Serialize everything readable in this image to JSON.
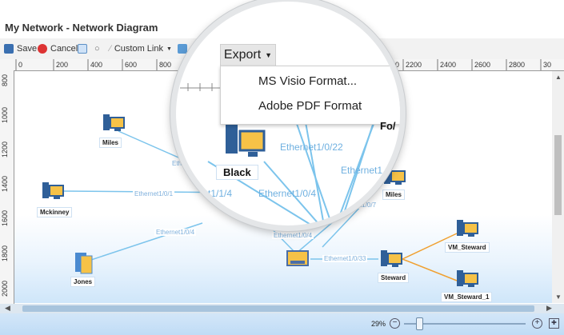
{
  "window": {
    "title": "My Network - Network Diagram"
  },
  "toolbar": {
    "save_label": "Save",
    "cancel_label": "Cancel",
    "custom_link_label": "Custom Link",
    "export_label": "Export"
  },
  "export_menu": {
    "items": [
      "MS Visio Format...",
      "Adobe PDF Format"
    ]
  },
  "rulers": {
    "horizontal": [
      "0",
      "200",
      "400",
      "600",
      "800",
      "200",
      "2200",
      "2400",
      "2600",
      "2800",
      "30"
    ],
    "vertical": [
      "800",
      "1000",
      "1200",
      "1400",
      "1600",
      "1800",
      "2000"
    ]
  },
  "nodes": {
    "miles_left": "Miles",
    "mckinney": "Mckinney",
    "jones": "Jones",
    "black": "Black",
    "fo_partial": "Fo/",
    "miles_right": "Miles",
    "steward": "Steward",
    "vm_steward": "VM_Steward",
    "vm_steward_1": "VM_Steward_1"
  },
  "edges": {
    "e_miles": "Ethern",
    "e_mckinney": "Ethernet1/0/1",
    "e_jones": "Ethernet1/0/4",
    "e_center": "Ethernet1/0/4",
    "e_steward": "Ethernet1/0/33",
    "e_miles_right": "Ethernet1/0/7",
    "lens_e1": "Ethernet1/0/22",
    "lens_e2": "Ethernet1",
    "lens_e3": "Ethernet1/0/4",
    "lens_e4": "t1/1/4"
  },
  "status": {
    "zoom": "29%"
  },
  "colors": {
    "accent": "#1e73be",
    "edge": "#7cc4ec",
    "vm_edge": "#f0a030"
  }
}
